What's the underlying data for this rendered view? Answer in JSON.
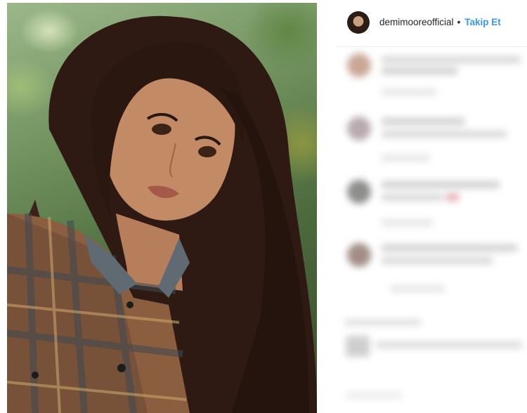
{
  "post": {
    "photo_description_icon": "portrait-photo"
  },
  "header": {
    "username": "demimooreofficial",
    "separator": "•",
    "follow_label": "Takip Et"
  },
  "colors": {
    "link": "#3897f0",
    "text": "#262626",
    "divider": "#efefef"
  }
}
